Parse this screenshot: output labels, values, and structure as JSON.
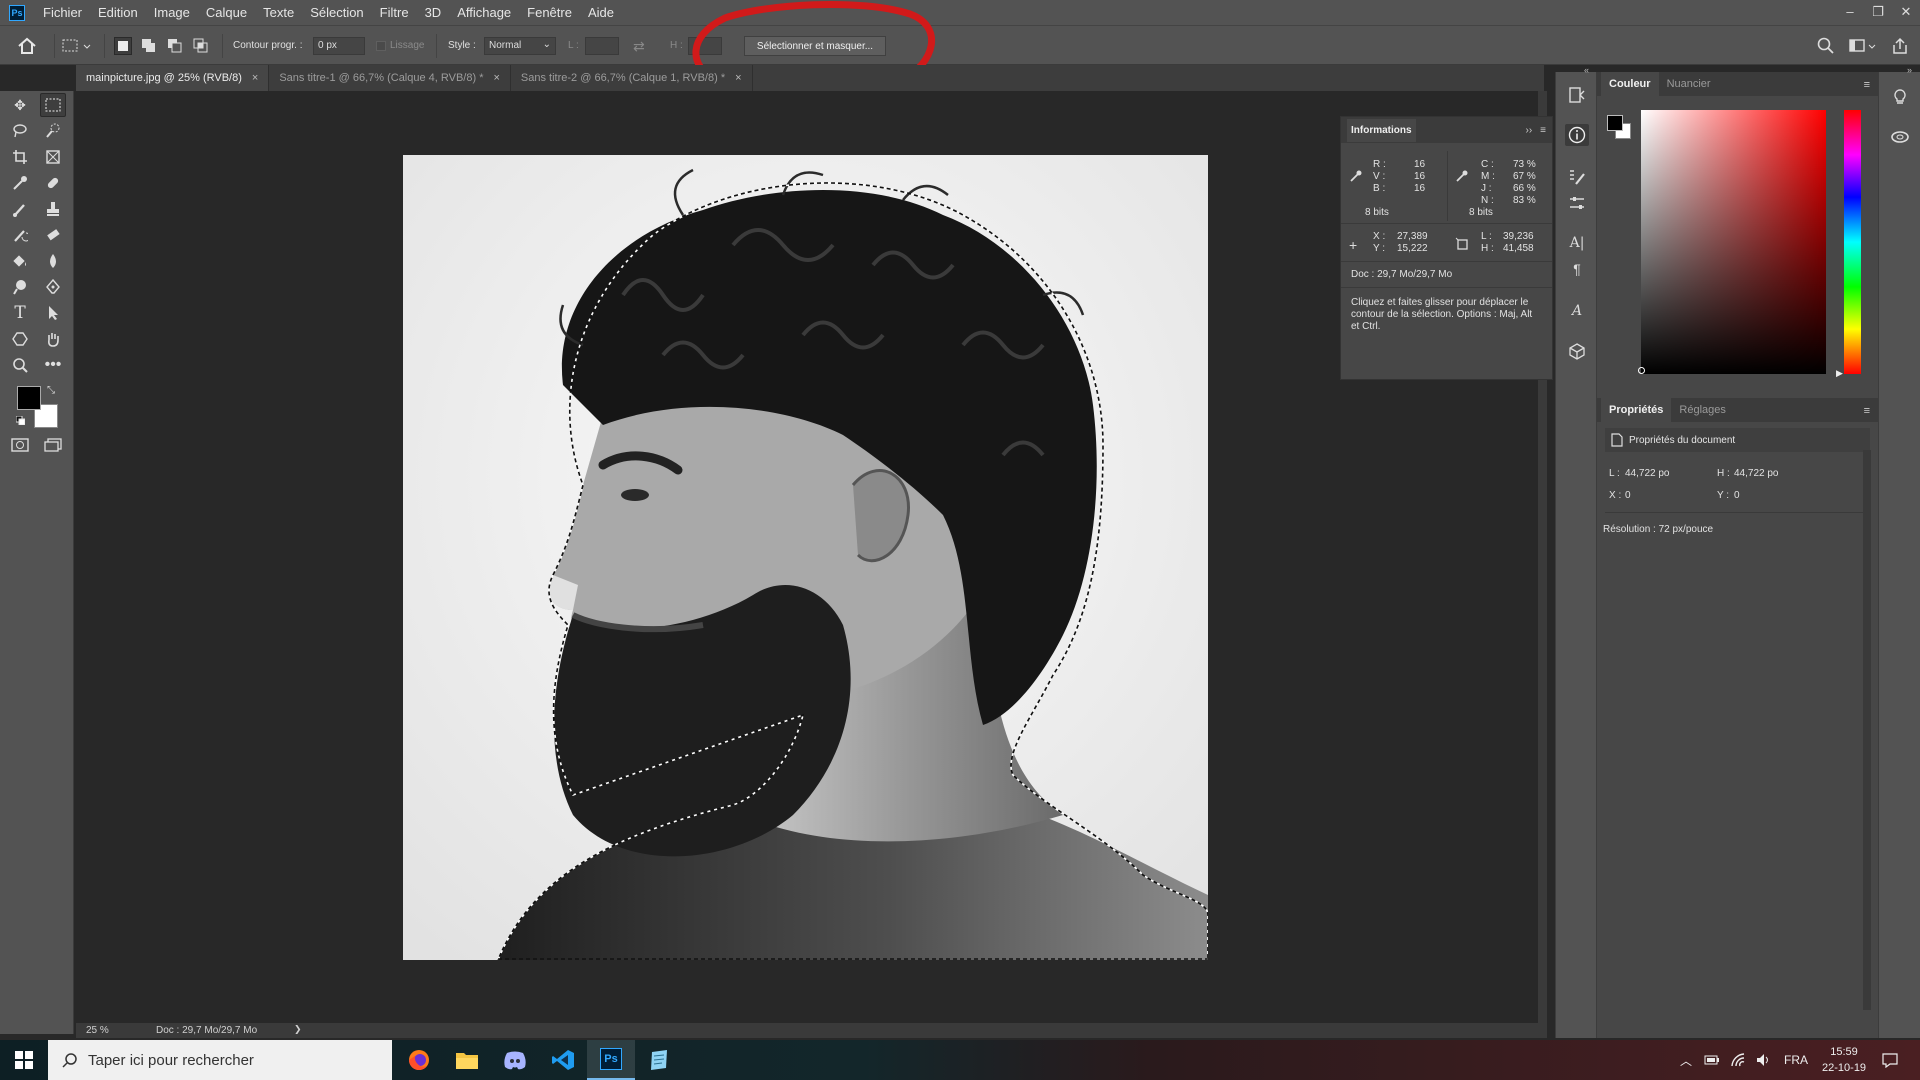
{
  "app": {
    "logo": "Ps"
  },
  "menu": [
    "Fichier",
    "Edition",
    "Image",
    "Calque",
    "Texte",
    "Sélection",
    "Filtre",
    "3D",
    "Affichage",
    "Fenêtre",
    "Aide"
  ],
  "window_controls": [
    "–",
    "❐",
    "✕"
  ],
  "options": {
    "contour_label": "Contour progr. :",
    "contour_value": "0 px",
    "lissage_label": "Lissage",
    "style_label": "Style :",
    "style_value": "Normal",
    "l_label": "L :",
    "h_label": "H :",
    "select_mask_button": "Sélectionner et masquer..."
  },
  "tabs": [
    {
      "label": "mainpicture.jpg @ 25% (RVB/8)",
      "close": "×"
    },
    {
      "label": "Sans titre-1 @ 66,7% (Calque 4, RVB/8) *",
      "close": "×"
    },
    {
      "label": "Sans titre-2 @ 66,7% (Calque 1, RVB/8) *",
      "close": "×"
    }
  ],
  "info_panel": {
    "title": "Informations",
    "rgb": {
      "r_label": "R :",
      "r": "16",
      "v_label": "V :",
      "v": "16",
      "b_label": "B :",
      "b": "16",
      "bits": "8 bits"
    },
    "cmjn": {
      "c_label": "C :",
      "c": "73 %",
      "m_label": "M :",
      "m": "67 %",
      "j_label": "J :",
      "j": "66 %",
      "n_label": "N :",
      "n": "83 %",
      "bits": "8 bits"
    },
    "pos": {
      "x_label": "X :",
      "x": "27,389",
      "y_label": "Y :",
      "y": "15,222"
    },
    "size": {
      "l_label": "L :",
      "l": "39,236",
      "h_label": "H :",
      "h": "41,458"
    },
    "doc": "Doc : 29,7 Mo/29,7 Mo",
    "hint": "Cliquez et faites glisser pour déplacer le contour de la sélection. Options : Maj, Alt et Ctrl."
  },
  "color_panel": {
    "tabs": [
      "Couleur",
      "Nuancier"
    ],
    "fg": "#000000",
    "bg": "#ffffff",
    "hue": "#ff0000"
  },
  "props_panel": {
    "tabs": [
      "Propriétés",
      "Réglages"
    ],
    "doc_title": "Propriétés du document",
    "l_label": "L :",
    "l": "44,722 po",
    "h_label": "H :",
    "h": "44,722 po",
    "x_label": "X :",
    "x": "0",
    "y_label": "Y :",
    "y": "0",
    "resolution": "Résolution : 72 px/pouce"
  },
  "status": {
    "zoom": "25 %",
    "doc": "Doc : 29,7 Mo/29,7 Mo",
    "arrow": "❯"
  },
  "taskbar": {
    "search_placeholder": "Taper ici pour rechercher",
    "lang": "FRA",
    "time": "15:59",
    "date": "22-10-19"
  },
  "colors": {
    "annotation_red": "#d11a1a",
    "ps_blue": "#31a8ff",
    "accent": "#76b9ed"
  }
}
